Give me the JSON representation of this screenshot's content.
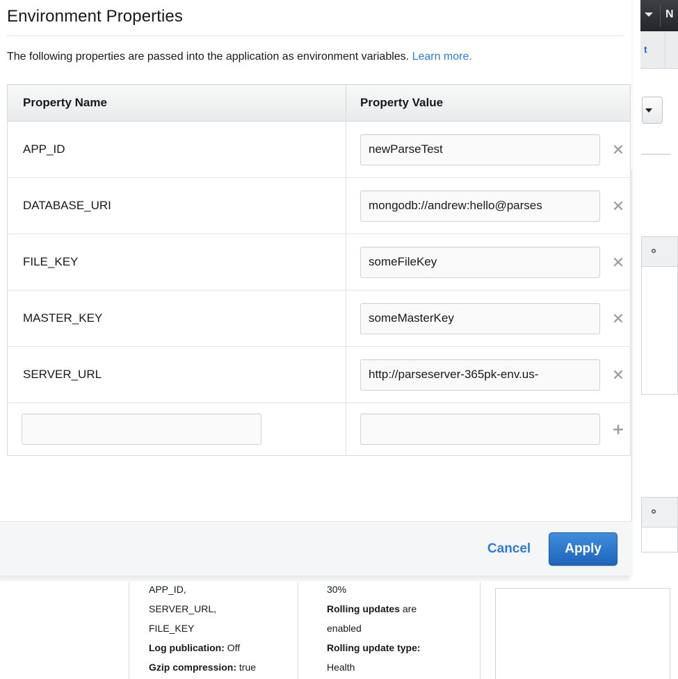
{
  "background": {
    "nav": {
      "caret_icon": "chevron-down-icon",
      "letter": "N"
    },
    "subbar": {
      "link_fragment": "t"
    },
    "mini_select": {
      "caret_icon": "chevron-down-icon"
    },
    "panel_fragments": [
      {
        "gear_icon": "gear-icon"
      },
      {
        "gear_icon": "gear-icon"
      }
    ],
    "dashboard_columns": [
      {
        "lines": [
          {
            "text": "APP_ID,",
            "bold": false
          },
          {
            "text": "SERVER_URL,",
            "bold": false
          },
          {
            "text": "FILE_KEY",
            "bold": false
          },
          {
            "label": "Log publication:",
            "value": " Off"
          },
          {
            "label": "Gzip compression:",
            "value": " true"
          }
        ]
      },
      {
        "lines": [
          {
            "text": "30%",
            "bold": false
          },
          {
            "label": "Rolling updates",
            "value": " are"
          },
          {
            "text": "enabled",
            "bold": false
          },
          {
            "label": "Rolling update type:",
            "value": ""
          },
          {
            "text": "Health",
            "bold": false
          }
        ]
      }
    ]
  },
  "modal": {
    "title": "Environment Properties",
    "description_prefix": "The following properties are passed into the application as environment variables. ",
    "description_link": "Learn more.",
    "table": {
      "headers": {
        "name": "Property Name",
        "value": "Property Value"
      },
      "rows": [
        {
          "name": "APP_ID",
          "value": "newParseTest",
          "remove_icon": "close-icon"
        },
        {
          "name": "DATABASE_URI",
          "value": "mongodb://andrew:hello@parses",
          "remove_icon": "close-icon"
        },
        {
          "name": "FILE_KEY",
          "value": "someFileKey",
          "remove_icon": "close-icon"
        },
        {
          "name": "MASTER_KEY",
          "value": "someMasterKey",
          "remove_icon": "close-icon"
        },
        {
          "name": "SERVER_URL",
          "value": "http://parseserver-365pk-env.us-",
          "remove_icon": "close-icon"
        }
      ],
      "new_row": {
        "name_value": "",
        "name_placeholder": "",
        "value_value": "",
        "value_placeholder": "",
        "add_icon": "plus-icon"
      }
    },
    "footer": {
      "cancel_label": "Cancel",
      "apply_label": "Apply"
    }
  },
  "colors": {
    "link": "#2e7bd6",
    "primary_button": "#1e64bb",
    "header_gradient_top": "#f7f8f8",
    "header_gradient_bottom": "#e9eaeb",
    "footer_background": "#f5f6f7",
    "nav_dark": "#232528"
  }
}
